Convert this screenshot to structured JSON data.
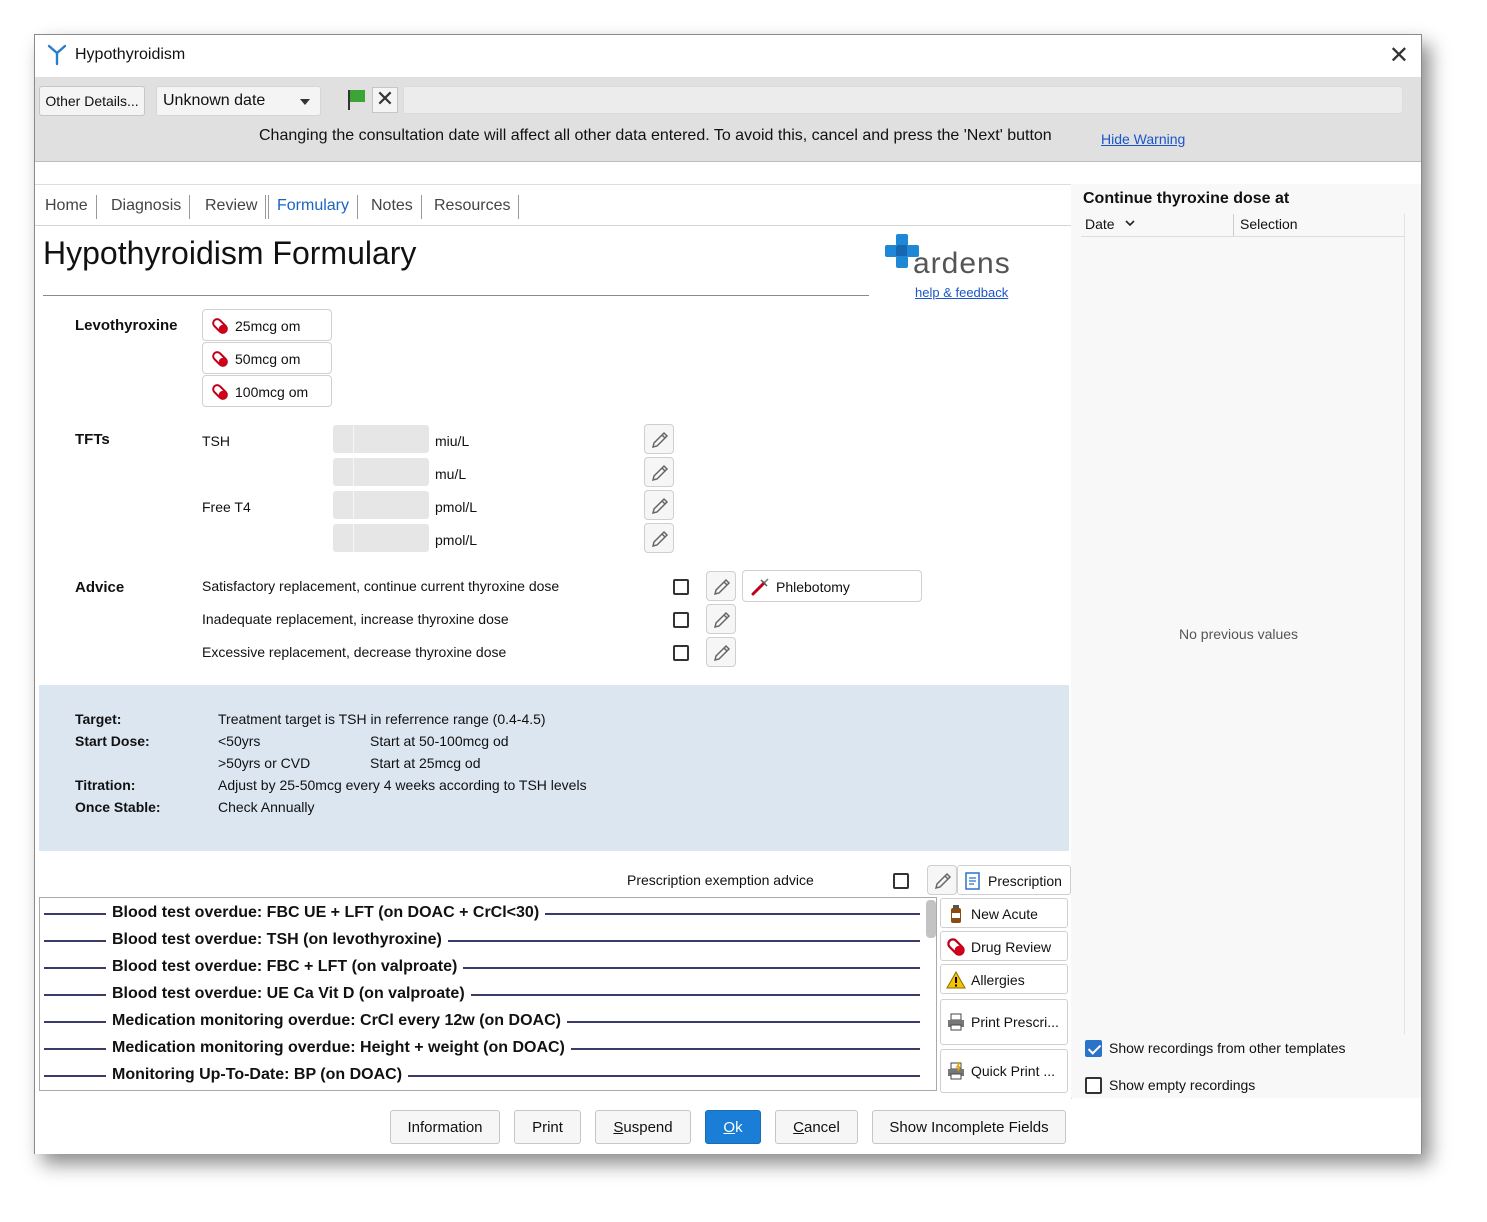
{
  "window": {
    "title": "Hypothyroidism",
    "close": "✕"
  },
  "toolbar": {
    "other_details": "Other Details...",
    "date_value": "Unknown date",
    "warning": "Changing the consultation date will affect all other data entered. To avoid this, cancel and press the 'Next' button",
    "hide_warning": "Hide Warning"
  },
  "tabs": [
    "Home",
    "Diagnosis",
    "Review",
    "Formulary",
    "Notes",
    "Resources"
  ],
  "active_tab": "Formulary",
  "page": {
    "title": "Hypothyroidism Formulary",
    "logo": "ardens",
    "logo_link": "help & feedback"
  },
  "levothyroxine": {
    "label": "Levothyroxine",
    "doses": [
      "25mcg om",
      "50mcg om",
      "100mcg om"
    ]
  },
  "tfts": {
    "label": "TFTs",
    "rows": [
      {
        "name": "TSH",
        "unit": "miu/L"
      },
      {
        "name": "",
        "unit": "mu/L"
      },
      {
        "name": "Free T4",
        "unit": "pmol/L"
      },
      {
        "name": "",
        "unit": "pmol/L"
      }
    ]
  },
  "advice": {
    "label": "Advice",
    "items": [
      "Satisfactory replacement, continue current thyroxine dose",
      "Inadequate replacement, increase thyroxine dose",
      "Excessive replacement, decrease thyroxine dose"
    ],
    "phlebotomy": "Phlebotomy"
  },
  "info": {
    "target_k": "Target:",
    "target_v": "Treatment target is TSH in referrence range (0.4-4.5)",
    "start_k": "Start Dose:",
    "start_a1": "<50yrs",
    "start_a2": "Start at 50-100mcg od",
    "start_b1": ">50yrs or CVD",
    "start_b2": "Start at 25mcg od",
    "titration_k": "Titration:",
    "titration_v": "Adjust by 25-50mcg every 4 weeks according to TSH levels",
    "stable_k": "Once Stable:",
    "stable_v": "Check Annually"
  },
  "prescription_exemption": "Prescription exemption advice",
  "alerts": [
    "Blood test overdue: FBC UE + LFT (on DOAC + CrCl<30)",
    "Blood test overdue: TSH (on levothyroxine)",
    "Blood test overdue: FBC + LFT (on valproate)",
    "Blood test overdue: UE Ca Vit D (on valproate)",
    "Medication monitoring overdue: CrCl every 12w (on DOAC)",
    "Medication monitoring overdue: Height + weight (on DOAC)",
    "Monitoring Up-To-Date: BP (on DOAC)"
  ],
  "side_buttons": {
    "prescription": "Prescription",
    "new_acute": "New Acute",
    "drug_review": "Drug Review",
    "allergies": "Allergies",
    "print_prescri": "Print Prescri...",
    "quick_print": "Quick Print ..."
  },
  "right_pane": {
    "title": "Continue thyroxine dose at",
    "col_date": "Date",
    "col_selection": "Selection",
    "empty": "No previous values",
    "show_other": "Show recordings from other templates",
    "show_other_checked": true,
    "show_empty": "Show empty recordings",
    "show_empty_checked": false
  },
  "footer": {
    "information": "Information",
    "print": "Print",
    "suspend_u": "S",
    "suspend_rest": "uspend",
    "ok_u": "O",
    "ok_rest": "k",
    "cancel_u": "C",
    "cancel_rest": "ancel",
    "show_incomplete": "Show Incomplete Fields"
  },
  "colors": {
    "accent": "#1b7ed6",
    "info_panel": "#dce6f1",
    "tab_active": "#1a64c4",
    "logo_blue": "#1e88d6"
  }
}
